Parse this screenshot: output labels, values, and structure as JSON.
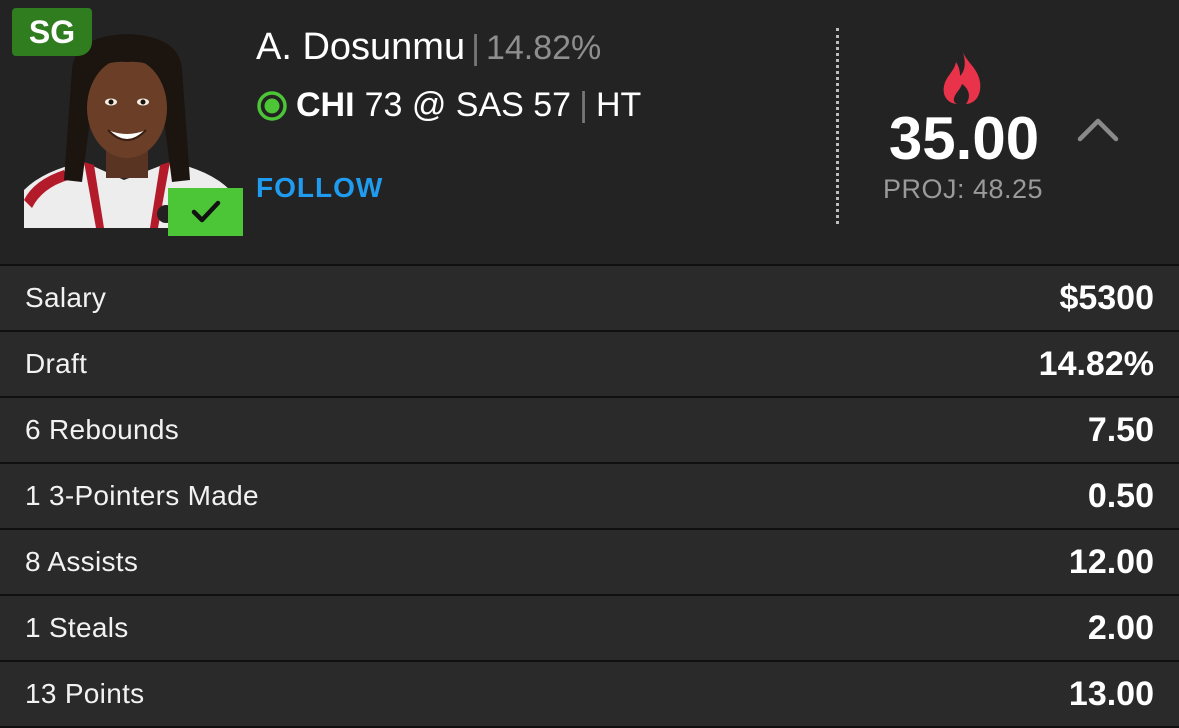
{
  "player": {
    "position": "SG",
    "name": "A. Dosunmu",
    "separator": "|",
    "ownership": "14.82%",
    "game": {
      "team": "CHI",
      "score_text": "73 @ SAS 57",
      "separator": "|",
      "status": "HT"
    },
    "follow_label": "FOLLOW"
  },
  "fantasy": {
    "points": "35.00",
    "projection": "PROJ: 48.25"
  },
  "icons": {
    "hot": "flame-icon",
    "live": "live-indicator-icon",
    "selected": "check-icon",
    "collapse": "chevron-up-icon"
  },
  "colors": {
    "position_badge": "#2f7d1f",
    "check_badge": "#4cc536",
    "follow": "#1f9cf0",
    "flame": "#e8334a",
    "live": "#4cc536"
  },
  "stats": [
    {
      "label": "Salary",
      "value": "$5300"
    },
    {
      "label": "Draft",
      "value": "14.82%"
    },
    {
      "label": "6 Rebounds",
      "value": "7.50"
    },
    {
      "label": "1 3-Pointers Made",
      "value": "0.50"
    },
    {
      "label": "8 Assists",
      "value": "12.00"
    },
    {
      "label": "1 Steals",
      "value": "2.00"
    },
    {
      "label": "13 Points",
      "value": "13.00"
    }
  ]
}
